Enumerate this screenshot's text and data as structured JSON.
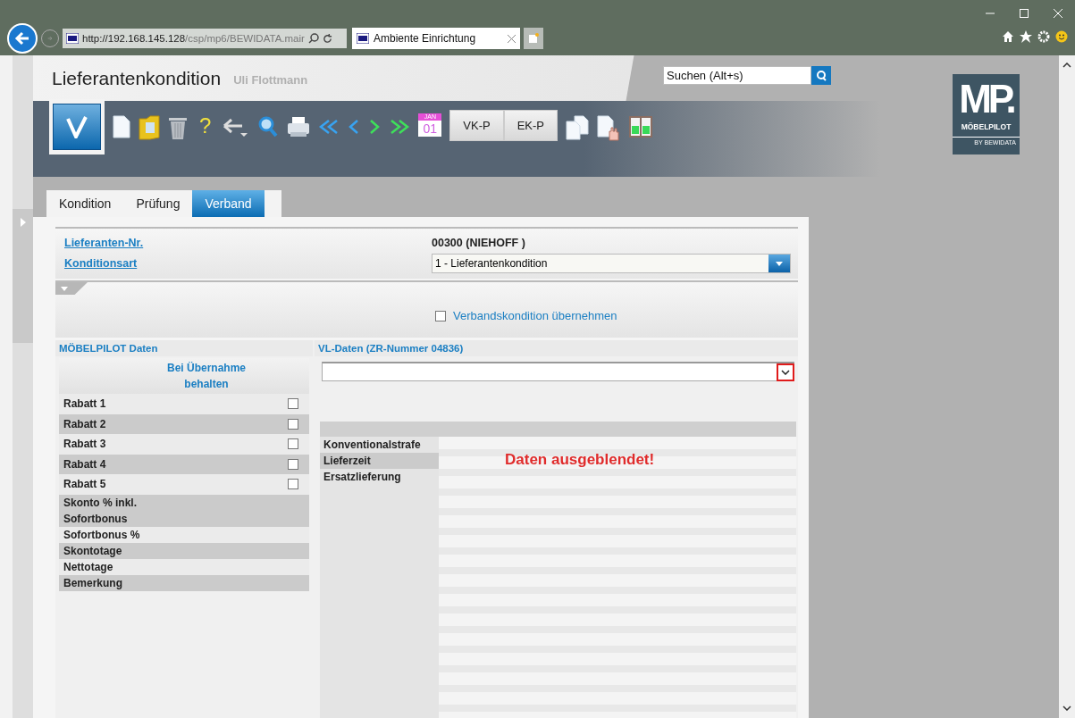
{
  "browser": {
    "url_host": "http://192.168.145.128",
    "url_path": "/csp/mp6/BEWIDATA.mair",
    "tab_title": "Ambiente Einrichtung"
  },
  "header": {
    "title": "Lieferantenkondition",
    "user": "Uli Flottmann",
    "search_placeholder": "Suchen (Alt+s)",
    "logo_text": "MP.",
    "logo_name": "MÖBELPILOT",
    "logo_sub": "BY BEWIDATA"
  },
  "toolbar": {
    "help_glyph": "?",
    "buttons": [
      "VK-P",
      "EK-P"
    ],
    "calendar_day": "01",
    "calendar_month": "JAN"
  },
  "tabs": [
    {
      "label": "Kondition",
      "selected": false
    },
    {
      "label": "Prüfung",
      "selected": false
    },
    {
      "label": "Verband",
      "selected": true
    }
  ],
  "supplier": {
    "number_label": "Lieferanten-Nr.",
    "number_value": "00300 (NIEHOFF )",
    "type_label": "Konditionsart",
    "type_value": "1 - Lieferantenkondition"
  },
  "options_panel": {
    "expanded": true
  },
  "adopt": {
    "label": "Verbandskondition übernehmen",
    "checked": false
  },
  "mp_data": {
    "title": "MÖBELPILOT Daten",
    "keep_header": "Bei Übernahme behalten",
    "rows": [
      {
        "label": "Rabatt 1",
        "kind": "checkbox",
        "checked": false
      },
      {
        "label": "Rabatt 2",
        "kind": "checkbox",
        "checked": false
      },
      {
        "label": "Rabatt 3",
        "kind": "checkbox",
        "checked": false
      },
      {
        "label": "Rabatt 4",
        "kind": "checkbox",
        "checked": false
      },
      {
        "label": "Rabatt 5",
        "kind": "checkbox",
        "checked": false
      },
      {
        "label": "Skonto % inkl.",
        "kind": "plain"
      },
      {
        "label": "Sofortbonus",
        "kind": "plain"
      },
      {
        "label": "Sofortbonus %",
        "kind": "plain"
      },
      {
        "label": "Skontotage",
        "kind": "plain"
      },
      {
        "label": "Nettotage",
        "kind": "plain"
      },
      {
        "label": "Bemerkung",
        "kind": "plain"
      }
    ]
  },
  "vl_data": {
    "title": "VL-Daten (ZR-Nummer 04836)",
    "rows": [
      "Konventionalstrafe",
      "Lieferzeit",
      "Ersatzlieferung"
    ],
    "hidden_notice": "Daten ausgeblendet!"
  }
}
